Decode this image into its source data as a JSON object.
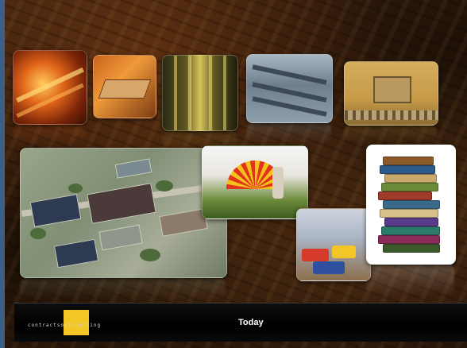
{
  "logo": {
    "text": "contractsoutsourcing",
    "icon": "logo-square-icon",
    "color": "#f2c626"
  },
  "nav": {
    "today_label": "Today"
  },
  "gallery": {
    "tiles": [
      {
        "name": "furnace-image"
      },
      {
        "name": "steel-slab-image"
      },
      {
        "name": "warehouse-aisle-image"
      },
      {
        "name": "machinery-image"
      },
      {
        "name": "conveyor-image"
      },
      {
        "name": "aerial-factory-image"
      },
      {
        "name": "sunburst-mural-image"
      },
      {
        "name": "trucks-image"
      },
      {
        "name": "books-stack-image"
      }
    ]
  },
  "colors": {
    "left_edge": "#3b5f86",
    "bar_bg": "#000000"
  }
}
